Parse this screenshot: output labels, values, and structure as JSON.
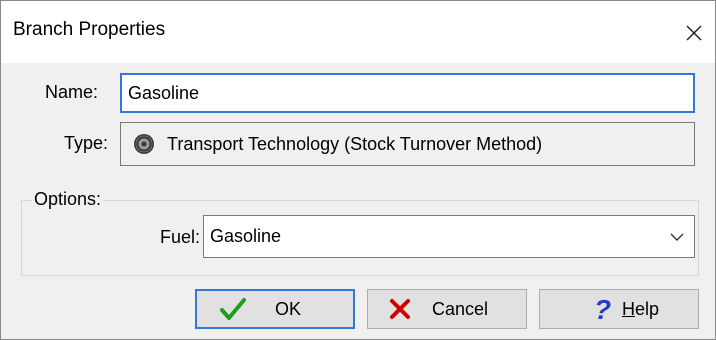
{
  "window": {
    "title": "Branch Properties"
  },
  "fields": {
    "name_label": "Name:",
    "name_value": "Gasoline",
    "type_label": "Type:",
    "type_value": "Transport Technology (Stock Turnover Method)",
    "type_icon": "transport-tire-icon"
  },
  "options": {
    "group_label": "Options:",
    "fuel_label": "Fuel:",
    "fuel_value": "Gasoline"
  },
  "buttons": {
    "ok_label": "OK",
    "cancel_label": "Cancel",
    "help_mnemonic": "H",
    "help_rest": "elp"
  },
  "colors": {
    "focus_blue": "#2f7ad6",
    "ok_check_green": "#1e9e1e",
    "cancel_x_red": "#d00000",
    "help_blue": "#1f3fbf"
  }
}
